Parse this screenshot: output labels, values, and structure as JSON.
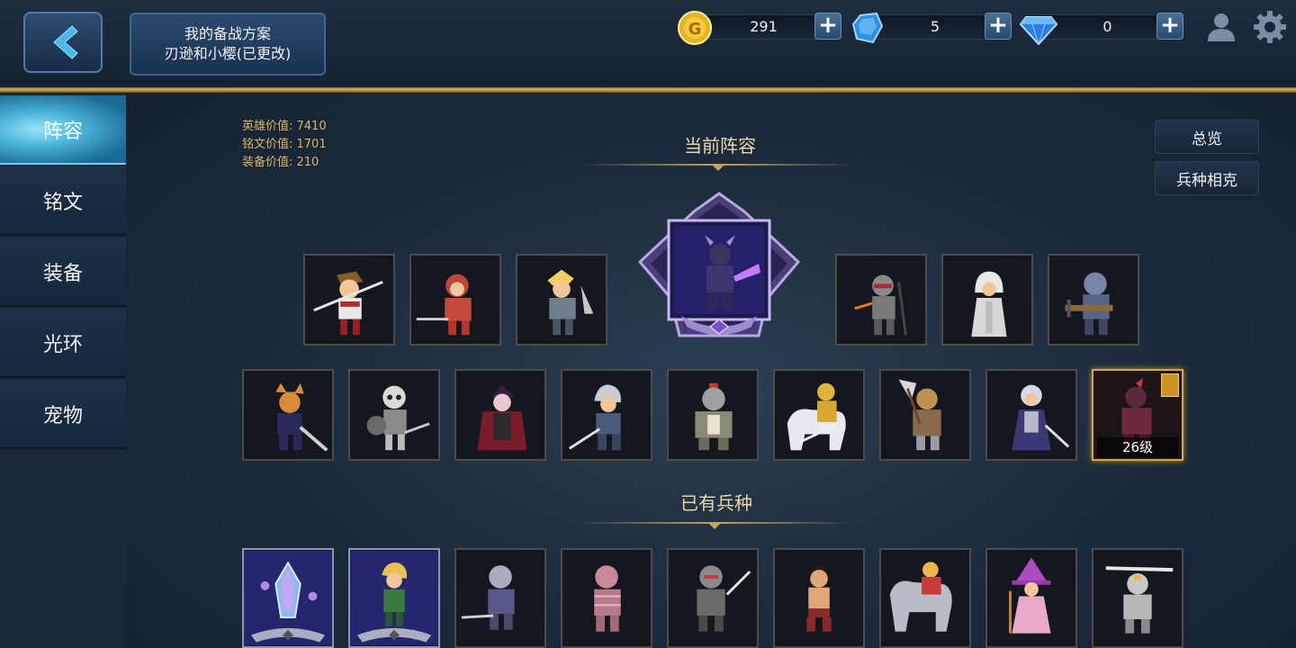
{
  "header": {
    "plan_line1": "我的备战方案",
    "plan_line2": "刃逊和小樱(已更改)"
  },
  "resources": {
    "gold": "291",
    "crystal": "5",
    "diamond": "0"
  },
  "sidebar": {
    "items": [
      {
        "label": "阵容"
      },
      {
        "label": "铭文"
      },
      {
        "label": "装备"
      },
      {
        "label": "光环"
      },
      {
        "label": "宠物"
      }
    ]
  },
  "stats": {
    "hero_value": "英雄价值: 7410",
    "inscription_value": "铭文价值: 1701",
    "equipment_value": "装备价值: 210"
  },
  "sections": {
    "current_lineup": "当前阵容",
    "owned_units": "已有兵种"
  },
  "buttons": {
    "overview": "总览",
    "counter": "兵种相克"
  },
  "selected_unit": {
    "level": "26级"
  },
  "colors": {
    "accent_gold": "#c9a45b",
    "active_tab": "#4ab3d8",
    "selected_border": "#d7a84a"
  },
  "icons": {
    "back": "chevron-left-icon",
    "gold": "gold-coin-icon",
    "crystal": "blue-crystal-icon",
    "diamond": "diamond-icon",
    "profile": "person-icon",
    "settings": "gear-icon"
  }
}
